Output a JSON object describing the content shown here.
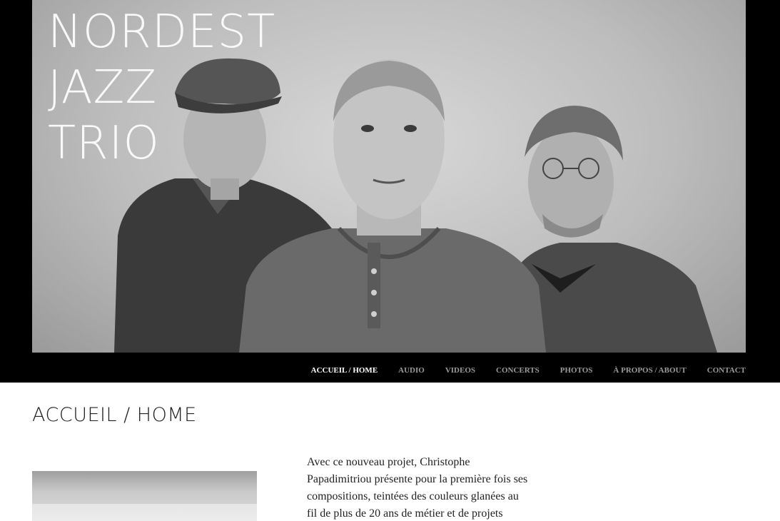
{
  "site": {
    "title_lines": [
      "NORDEST",
      "JAZZ",
      "TRIO"
    ]
  },
  "nav": {
    "items": [
      {
        "label": "ACCUEIL / HOME",
        "active": true
      },
      {
        "label": "AUDIO",
        "active": false
      },
      {
        "label": "VIDEOS",
        "active": false
      },
      {
        "label": "CONCERTS",
        "active": false
      },
      {
        "label": "PHOTOS",
        "active": false
      },
      {
        "label": "À PROPOS / ABOUT",
        "active": false
      },
      {
        "label": "CONTACT",
        "active": false
      }
    ]
  },
  "main": {
    "page_title": "ACCUEIL / HOME",
    "intro_lines": [
      "Avec ce nouveau projet, Christophe",
      "Papadimitriou présente pour la première fois ses",
      "compositions, teintées des couleurs glanées au",
      "fil de plus de 20 ans de métier et de projets"
    ]
  },
  "colors": {
    "header_bg": "#000000",
    "nav_active": "#ffffff",
    "nav_inactive": "#9a9a9a",
    "body_text": "#222222"
  }
}
